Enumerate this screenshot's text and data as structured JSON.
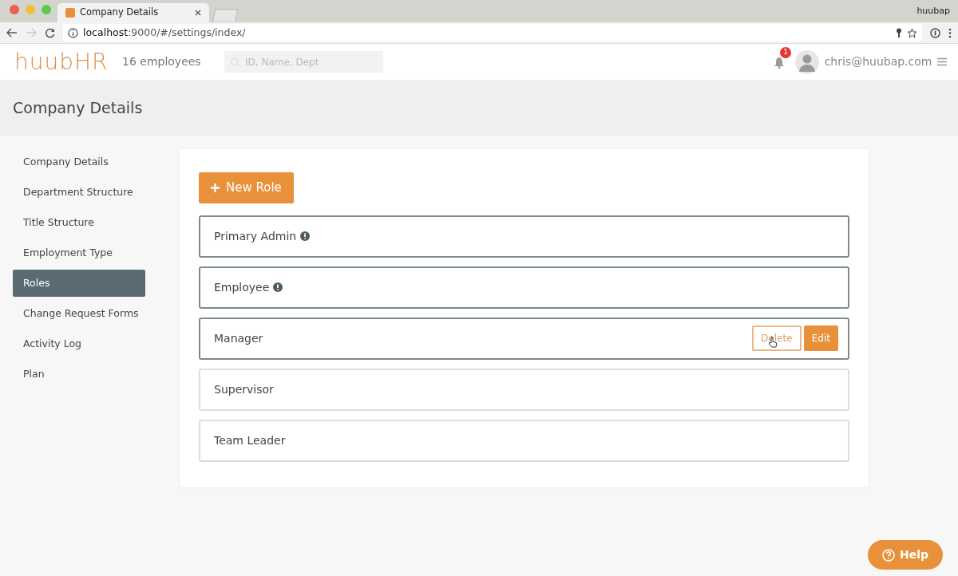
{
  "browser": {
    "tab_title": "Company Details",
    "profile": "huubap",
    "url_host": "localhost",
    "url_path": ":9000/#/settings/index/"
  },
  "header": {
    "logo": "huubHR",
    "employees": "16 employees",
    "search": {
      "placeholder": "ID, Name, Dept"
    },
    "notifications": "1",
    "user": "chris@huubap.com"
  },
  "page_title": "Company Details",
  "sidebar": {
    "items": [
      {
        "label": "Company Details",
        "selected": false
      },
      {
        "label": "Department Structure",
        "selected": false
      },
      {
        "label": "Title Structure",
        "selected": false
      },
      {
        "label": "Employment Type",
        "selected": false
      },
      {
        "label": "Roles",
        "selected": true
      },
      {
        "label": "Change Request Forms",
        "selected": false
      },
      {
        "label": "Activity Log",
        "selected": false
      },
      {
        "label": "Plan",
        "selected": false
      }
    ]
  },
  "new_role_button": "New Role",
  "roles": [
    {
      "name": "Primary Admin",
      "info": true,
      "highlighted": true
    },
    {
      "name": "Employee",
      "info": true,
      "highlighted": true
    },
    {
      "name": "Manager",
      "info": false,
      "highlighted": true,
      "actions": [
        "Delete",
        "Edit"
      ]
    },
    {
      "name": "Supervisor",
      "info": false,
      "highlighted": false
    },
    {
      "name": "Team Leader",
      "info": false,
      "highlighted": false
    }
  ],
  "help_button": "Help"
}
